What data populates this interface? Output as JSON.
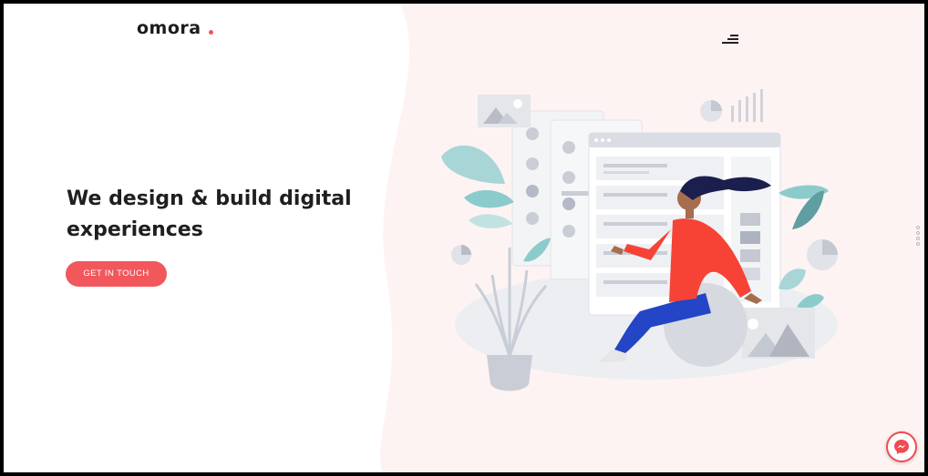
{
  "brand": {
    "name": "omora",
    "accent": "#f0565b"
  },
  "header": {
    "menu_icon": "hamburger-menu-icon"
  },
  "hero": {
    "headline": "We design & build digital experiences",
    "cta_label": "GET IN TOUCH"
  },
  "widgets": {
    "chat_icon": "messenger-icon"
  },
  "colors": {
    "background_right": "#fdf3f3",
    "button": "#f2575c",
    "text": "#1f1f1f"
  }
}
